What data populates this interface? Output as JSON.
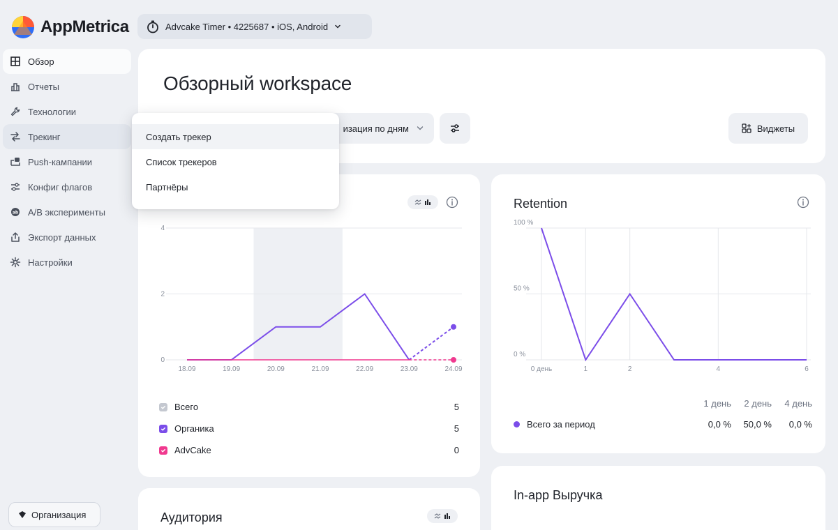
{
  "brand": {
    "name": "AppMetrica"
  },
  "app_switcher": {
    "label": "Advcake Timer • 4225687 • iOS, Android"
  },
  "sidebar": {
    "items": [
      {
        "label": "Обзор",
        "icon": "grid-icon",
        "active": true
      },
      {
        "label": "Отчеты",
        "icon": "bar-chart-icon"
      },
      {
        "label": "Технологии",
        "icon": "wrench-icon"
      },
      {
        "label": "Трекинг",
        "icon": "tracking-icon",
        "hover": true
      },
      {
        "label": "Push-кампании",
        "icon": "push-icon"
      },
      {
        "label": "Конфиг флагов",
        "icon": "flags-icon"
      },
      {
        "label": "A/B эксперименты",
        "icon": "ab-icon"
      },
      {
        "label": "Экспорт данных",
        "icon": "export-icon"
      },
      {
        "label": "Настройки",
        "icon": "gear-icon"
      }
    ],
    "org_button": "Организация"
  },
  "workspace": {
    "title": "Обзорный workspace",
    "period_select": "изация по дням",
    "widgets_button": "Виджеты"
  },
  "dropdown": {
    "items": [
      "Создать трекер",
      "Список трекеров",
      "Партнёры"
    ],
    "highlighted": 0
  },
  "users_card": {
    "legend": [
      {
        "name": "Всего",
        "value": "5",
        "color": "#b9bec8"
      },
      {
        "name": "Органика",
        "value": "5",
        "color": "#7b4de9"
      },
      {
        "name": "AdvCake",
        "value": "0",
        "color": "#f0398f"
      }
    ]
  },
  "retention_card": {
    "title": "Retention",
    "columns": [
      "1 день",
      "2 день",
      "4 день"
    ],
    "row_name": "Всего за период",
    "row_values": [
      "0,0 %",
      "50,0 %",
      "0,0 %"
    ]
  },
  "audience_card": {
    "title": "Аудитория"
  },
  "revenue_card": {
    "title": "In-app Выручка"
  },
  "chart_data": [
    {
      "type": "line",
      "categories": [
        "18.09",
        "19.09",
        "20.09",
        "21.09",
        "22.09",
        "23.09",
        "24.09"
      ],
      "ylim": [
        0,
        4
      ],
      "yticks": [
        "0",
        "2",
        "4"
      ],
      "series": [
        {
          "name": "Органика",
          "values": [
            0,
            0,
            1,
            1,
            2,
            0,
            1
          ],
          "color": "#7b4de9"
        },
        {
          "name": "AdvCake",
          "values": [
            0,
            0,
            0,
            0,
            0,
            0,
            0
          ],
          "color": "#f0398f"
        }
      ],
      "highlight_range": [
        "20.09",
        "21.09"
      ],
      "dashed_last_segment": true
    },
    {
      "type": "line",
      "title": "Retention",
      "x": [
        0,
        1,
        2,
        3,
        4,
        5,
        6
      ],
      "xticks": [
        "0 день",
        "1",
        "2",
        "4",
        "6"
      ],
      "xtick_positions": [
        0,
        1,
        2,
        4,
        6
      ],
      "yticks": [
        "0 %",
        "50 %",
        "100 %"
      ],
      "ylim": [
        0,
        100
      ],
      "series": [
        {
          "name": "Всего за период",
          "values": [
            100,
            0,
            50,
            0,
            0,
            0,
            0
          ],
          "color": "#7b4de9"
        }
      ]
    }
  ]
}
